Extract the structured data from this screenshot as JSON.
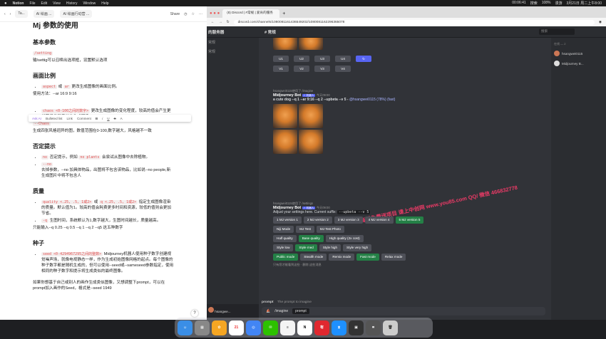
{
  "menubar": {
    "app": "Notion",
    "items": [
      "File",
      "Edit",
      "View",
      "History",
      "Window",
      "Help"
    ],
    "right": [
      "00:06:41",
      "搜索",
      "108%",
      "漫游",
      "3月21日 周二上午8:00"
    ]
  },
  "notion": {
    "tabs": [
      "Ta...",
      "AI 绘画 ...",
      "AI 绘画行动营 ..."
    ],
    "share": "Share",
    "title": "Mj 参数的使用",
    "h_basic": "基本参数",
    "setting_code": "/setting",
    "setting_desc": "输/settig可以召唤出选项框，设置默认选项",
    "h_ratio": "画面比例",
    "aspect_code1": "aspect",
    "aspect_or": "或",
    "aspect_code2": "ar",
    "aspect_desc": "更改生成图像的画面比例。",
    "usage": "使用方法：--ar 16:9  9:16",
    "toolbar": [
      "Ask AI",
      "Bulleted list",
      "Link",
      "Comment",
      "B",
      "i",
      "U",
      "S",
      "A"
    ],
    "chaos_code": "chaos <0-100之间的数字>",
    "chaos_desc": "更改生成图像的变化程度，较高的值会产生更加不寻常和意外的生成图像。",
    "chaos_line": "--Chaos",
    "chaos_note": "生成四张风格迥异的图，数值范围在0-100,数字越大，风格越不一致",
    "h_neg": "否定提示",
    "no_code": "no",
    "no_desc1": "否定提示，例如",
    "no_code2": "no plants",
    "no_desc2": "会尝试从图像中去除植物。",
    "no_line": "--no",
    "no_note": "去掉参数，--no 加具体物品，出图将不包含该物品，比如说--no people,新生成图片中将不包含人",
    "h_quality": "质量",
    "q_code1": "quality <.25, .5, 1或2>",
    "q_or": "或",
    "q_code2": "q <.25, .5, 1或2>",
    "q_desc": "指定生成图像渲染的质量。默认值为1。较高的值会耗费更多时间和资源，较低的值则会更加节省。",
    "q_code3": "-q",
    "q_note": "生图时间，系统默认为1,数字越大，生图时间越长，质量越高。",
    "q_input": "只能输入--q 0.25 --q 0.5 --q 1 --q 2  --q5 这五种数字",
    "h_seed": "种子",
    "seed_code": "seed <0-4294967295之间的整数>",
    "seed_desc": "Midjourney机器人使用种子数字创建视觉噪声场，就像电视静态一样，作为生成初始图像网格的起点。每个图像的种子数字都是随机生成的，但可以使用--seed或--sameseed参数指定，使用相同的种子数字和提示将生成类似的最终图像。",
    "seed_note": "如果你想基于自己或别人的画作生成类似图像，又想调整下prompt，可以在prompt加入画作的Seed，格式是--seed 1949",
    "help": "?"
  },
  "browser": {
    "tab1": "(8) Discord | #常规 | 爱肯的服务",
    "url": "discord.com/channels/1080081161436549202/1080081162296365078"
  },
  "discord": {
    "server": "的服务器",
    "channel": "# 常规",
    "search_placeholder": "搜索",
    "sidebar_items": [
      "常规",
      "常规"
    ],
    "user": "hsangwe...",
    "members_header": "在线 — 2",
    "members": [
      "hsangwei0115",
      "Midjourney B..."
    ],
    "vbuttons_row1": [
      "U1",
      "U2",
      "U3",
      "U4"
    ],
    "vbuttons_row2": [
      "V1",
      "V2",
      "V3",
      "V4"
    ],
    "reply_used": "hsangwei0115使用了 /imagine",
    "bot_name": "Midjourney Bot",
    "bot_tag": "✓ 机器人",
    "time1": "今天09:00",
    "prompt_text": "a cute dog --q 1 --ar 9:16 --q 2 --upbeta --v 5 -",
    "prompt_tail": "@hsangwei0115 (78%) (fast)",
    "reply_used2": "hsangwei0115使用了 /settings",
    "time2": "今天09:00",
    "settings_text": "Adjust your settings here. Current suffix:",
    "settings_suffix": "--upbeta --v 5",
    "version_buttons": [
      "1 MJ version 1",
      "2 MJ version 2",
      "3 MJ version 3",
      "4 MJ version 4",
      "5 MJ version 5"
    ],
    "row2": [
      "Niji Mode",
      "MJ Test",
      "MJ Test Photo"
    ],
    "row3": [
      "Half quality",
      "Base quality",
      "High quality (2x cost)"
    ],
    "row4": [
      "Style low",
      "Style med",
      "Style high",
      "Style very high"
    ],
    "row5": [
      "Public mode",
      "Stealth mode",
      "Remix mode",
      "Fast mode",
      "Relax mode"
    ],
    "only_you": "只有您才能看到这些 · 删除 这些消息",
    "watermark": "每周免费送项目 请上中创网 www.you85.com QQ/ 微信 466832778",
    "prompt_hint_label": "prompt",
    "prompt_hint_desc": "The prompt to imagine",
    "imagine_cmd": "/imagine",
    "imagine_arg": "prompt"
  },
  "dock": [
    "Finder",
    "Launchpad",
    "Photos",
    "Calendar",
    "Chrome",
    "WeChat",
    "Notes",
    "Notion",
    "有道",
    "Mirror",
    "Screen",
    "Tool",
    "Trash"
  ],
  "calendar_day": "21"
}
